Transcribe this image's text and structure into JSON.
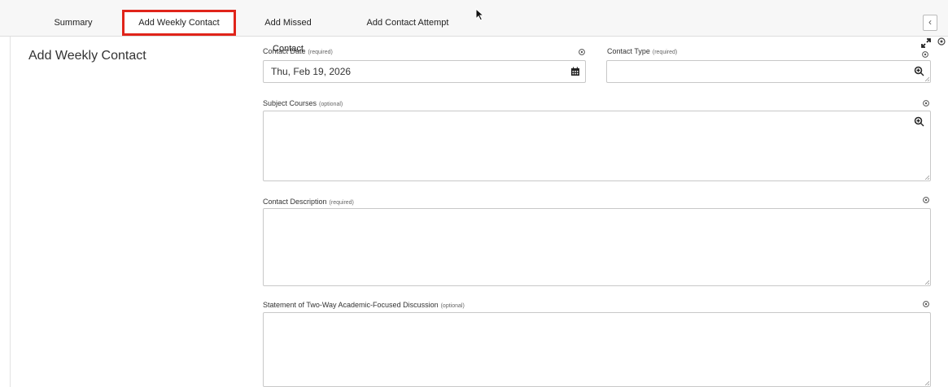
{
  "tabs": [
    {
      "label": "Summary"
    },
    {
      "label": "Add Weekly Contact"
    },
    {
      "label": "Add Missed Contact"
    },
    {
      "label": "Add Contact Attempt"
    }
  ],
  "page_title": "Add Weekly Contact",
  "fields": {
    "contact_date": {
      "label": "Contact Date",
      "hint": "(required)",
      "value": "Thu, Feb 19, 2026"
    },
    "contact_type": {
      "label": "Contact Type",
      "hint": "(required)",
      "value": ""
    },
    "subject_courses": {
      "label": "Subject Courses",
      "hint": "(optional)",
      "value": ""
    },
    "contact_description": {
      "label": "Contact Description",
      "hint": "(required)",
      "value": ""
    },
    "statement": {
      "label": "Statement of Two-Way Academic-Focused Discussion",
      "hint": "(optional)",
      "value": ""
    }
  },
  "icons": {
    "collapse": "chevron-left-icon",
    "expand": "expand-arrows-icon",
    "settings": "gear-icon",
    "calendar": "calendar-icon",
    "lookup": "zoom-in-icon"
  },
  "colors": {
    "active_tab_border": "#e0241a"
  }
}
